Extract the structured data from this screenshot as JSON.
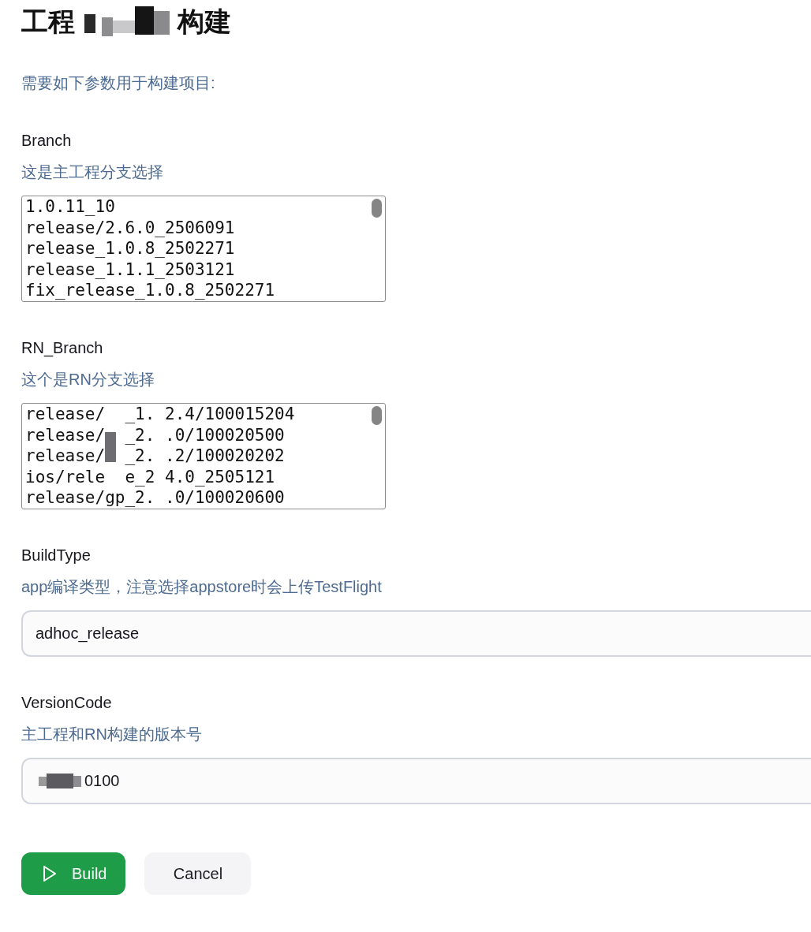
{
  "title": {
    "parts": [
      "工程",
      "构建"
    ]
  },
  "intro": "需要如下参数用于构建项目:",
  "parameters": [
    {
      "kind": "list",
      "name": "Branch",
      "description": "这是主工程分支选择",
      "options": [
        {
          "label": "1.0.11_10",
          "selected": false
        },
        {
          "label": "release/2.6.0_2506091",
          "selected": false
        },
        {
          "label": "release_1.0.8_2502271",
          "selected": false
        },
        {
          "label": "release_1.1.1_2503121",
          "selected": false
        },
        {
          "label": "fix_release_1.0.8_2502271",
          "selected": false
        }
      ]
    },
    {
      "kind": "list",
      "name": "RN_Branch",
      "description": "这个是RN分支选择",
      "redacted": true,
      "options": [
        {
          "label": "release/  _1. 2.4/100015204",
          "selected": false
        },
        {
          "label": "release/  _2. .0/100020500",
          "selected": false
        },
        {
          "label": "release/  _2. .2/100020202",
          "selected": false
        },
        {
          "label": "ios/rele  e_2 4.0_2505121",
          "selected": false
        },
        {
          "label": "release/gp_2. .0/100020600",
          "selected": false
        }
      ]
    },
    {
      "kind": "text",
      "name": "BuildType",
      "description": "app编译类型，注意选择appstore时会上传TestFlight",
      "value": "adhoc_release"
    },
    {
      "kind": "text",
      "name": "VersionCode",
      "description": "主工程和RN构建的版本号",
      "redacted": true,
      "value": "0100"
    }
  ],
  "buttons": [
    {
      "label": "Build",
      "kind": "primary"
    },
    {
      "label": "Cancel",
      "kind": "secondary"
    }
  ]
}
